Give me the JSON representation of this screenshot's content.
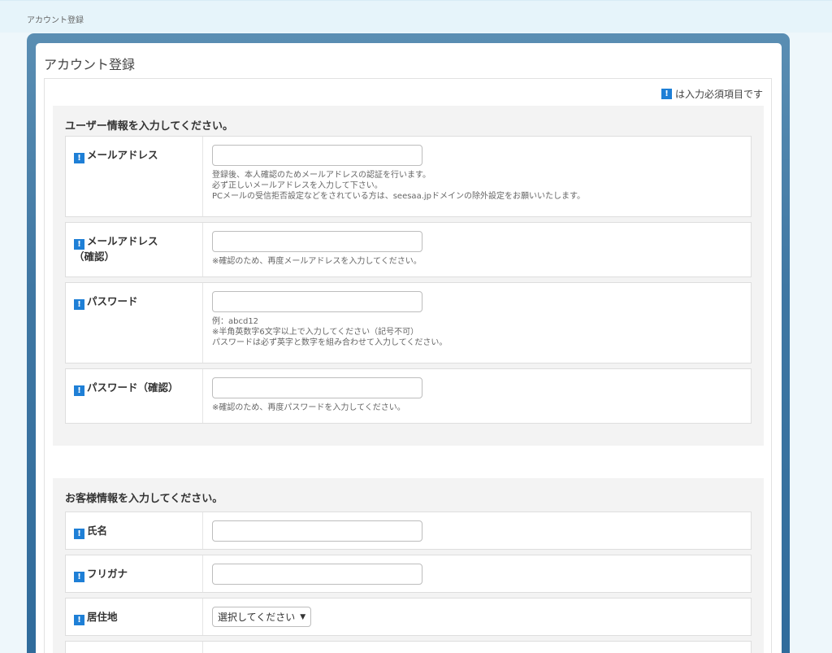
{
  "breadcrumb": "アカウント登録",
  "page_title": "アカウント登録",
  "required_note": "は入力必須項目です",
  "required_icon_symbol": "!",
  "colors": {
    "accent_blue": "#1e7fd6",
    "frame_blue": "#3f77a3",
    "background": "#eef7fb"
  },
  "user_section": {
    "heading": "ユーザー情報を入力してください。",
    "rows": [
      {
        "label": "メールアドレス",
        "value": "",
        "help": [
          "登録後、本人確認のためメールアドレスの認証を行います。",
          "必ず正しいメールアドレスを入力して下さい。",
          "PCメールの受信拒否設定などをされている方は、seesaa.jpドメインの除外設定をお願いいたします。"
        ]
      },
      {
        "label": "メールアドレス",
        "label_sub": "（確認）",
        "value": "",
        "help": [
          "※確認のため、再度メールアドレスを入力してください。"
        ]
      },
      {
        "label": "パスワード",
        "value": "",
        "help": [
          "例：abcd12",
          "※半角英数字6文字以上で入力してください（記号不可）",
          "パスワードは必ず英字と数字を組み合わせて入力してください。"
        ]
      },
      {
        "label": "パスワード（確認）",
        "value": "",
        "help": [
          "※確認のため、再度パスワードを入力してください。"
        ]
      }
    ]
  },
  "customer_section": {
    "heading": "お客様情報を入力してください。",
    "rows": [
      {
        "label": "氏名",
        "value": ""
      },
      {
        "label": "フリガナ",
        "value": ""
      },
      {
        "label": "居住地",
        "select_value": "選択してください",
        "caret_icon": "triangle-down-icon"
      }
    ]
  }
}
